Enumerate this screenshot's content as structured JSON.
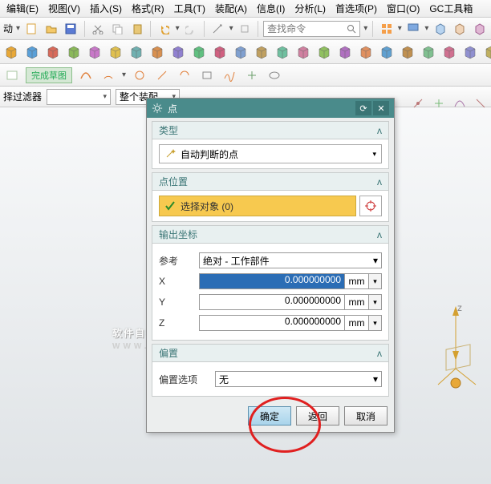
{
  "menu": [
    "编辑(E)",
    "视图(V)",
    "插入(S)",
    "格式(R)",
    "工具(T)",
    "装配(A)",
    "信息(I)",
    "分析(L)",
    "首选项(P)",
    "窗口(O)",
    "GC工具箱"
  ],
  "toolbar1": {
    "label0": "动",
    "search_placeholder": "查找命令"
  },
  "row3": {
    "tag": "完成草图"
  },
  "row4": {
    "filter_label": "择过滤器",
    "assembly": "整个装配"
  },
  "dialog": {
    "title": "点",
    "sec_type": "类型",
    "type_value": "自动判断的点",
    "sec_pos": "点位置",
    "select_obj": "选择对象 (0)",
    "sec_out": "输出坐标",
    "ref_label": "参考",
    "ref_value": "绝对 - 工作部件",
    "x_label": "X",
    "x_value": "0.000000000",
    "y_label": "Y",
    "y_value": "0.000000000",
    "z_label": "Z",
    "z_value": "0.000000000",
    "unit": "mm",
    "sec_offset": "偏置",
    "offset_label": "偏置选项",
    "offset_value": "无",
    "ok": "确定",
    "back": "返回",
    "cancel": "取消"
  },
  "watermark": {
    "main": "软件自学网",
    "sub": "WWW.RJZXW.COM"
  }
}
